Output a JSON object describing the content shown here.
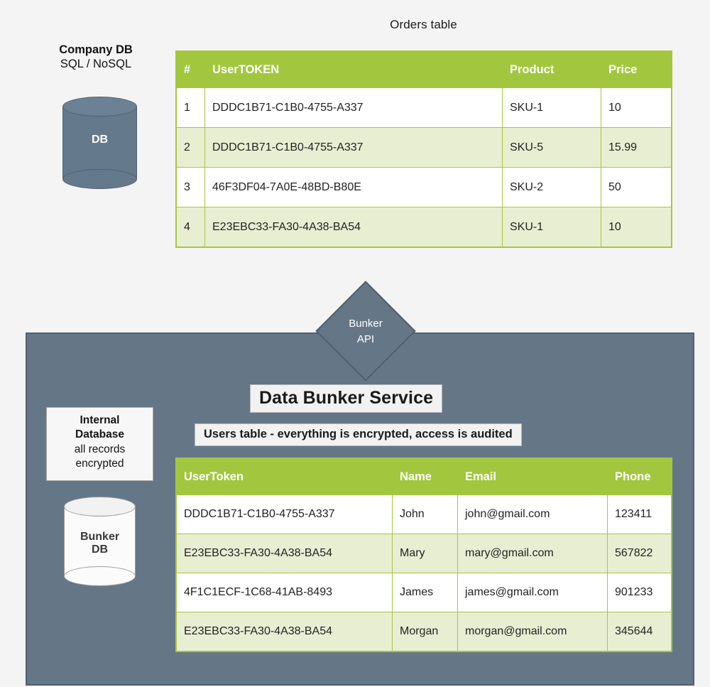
{
  "orders": {
    "title": "Orders table",
    "columns": [
      "#",
      "UserTOKEN",
      "Product",
      "Price"
    ],
    "rows": [
      {
        "num": "1",
        "token": "DDDC1B71-C1B0-4755-A337",
        "product": "SKU-1",
        "price": "10"
      },
      {
        "num": "2",
        "token": "DDDC1B71-C1B0-4755-A337",
        "product": "SKU-5",
        "price": "15.99"
      },
      {
        "num": "3",
        "token": "46F3DF04-7A0E-48BD-B80E",
        "product": "SKU-2",
        "price": "50"
      },
      {
        "num": "4",
        "token": "E23EBC33-FA30-4A38-BA54",
        "product": "SKU-1",
        "price": "10"
      }
    ]
  },
  "company_db": {
    "title": "Company DB",
    "subtitle": "SQL / NoSQL",
    "cylinder_label": "DB"
  },
  "bunker": {
    "api_node": "Bunker\nAPI",
    "api_line1": "Bunker",
    "api_line2": "API",
    "service_title": "Data Bunker Service",
    "users_caption": "Users table - everything is encrypted, access is audited",
    "internal_note_line1": "Internal",
    "internal_note_line2": "Database",
    "internal_note_line3": "all records",
    "internal_note_line4": "encrypted",
    "db_cylinder_line1": "Bunker",
    "db_cylinder_line2": "DB"
  },
  "users": {
    "columns": [
      "UserToken",
      "Name",
      "Email",
      "Phone"
    ],
    "rows": [
      {
        "token": "DDDC1B71-C1B0-4755-A337",
        "name": "John",
        "email": "john@gmail.com",
        "phone": "123411"
      },
      {
        "token": "E23EBC33-FA30-4A38-BA54",
        "name": "Mary",
        "email": "mary@gmail.com",
        "phone": "567822"
      },
      {
        "token": "4F1C1ECF-1C68-41AB-8493",
        "name": "James",
        "email": "james@gmail.com",
        "phone": "901233"
      },
      {
        "token": "E23EBC33-FA30-4A38-BA54",
        "name": "Morgan",
        "email": "morgan@gmail.com",
        "phone": "345644"
      }
    ]
  },
  "colors": {
    "table_header_green": "#a2c73f",
    "table_row_tint": "#e8eed2",
    "panel_slate": "#657787",
    "panel_border": "#4e5f71",
    "page_background": "#f4f4f4",
    "company_db_fill": "#64798c"
  }
}
